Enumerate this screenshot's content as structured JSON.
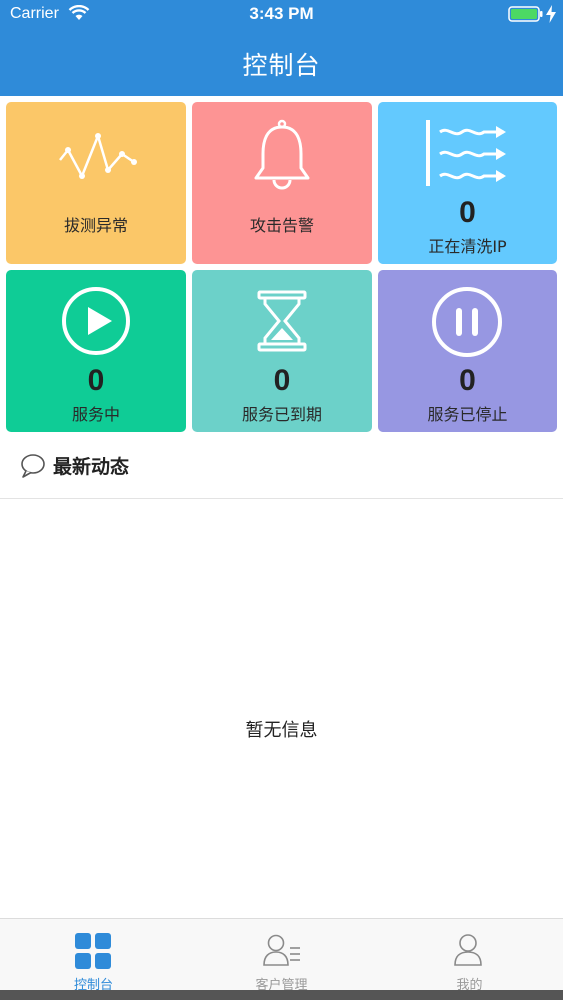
{
  "status_bar": {
    "carrier": "Carrier",
    "time": "3:43 PM"
  },
  "nav": {
    "title": "控制台"
  },
  "tiles": [
    {
      "label": "拔测异常",
      "icon": "wave-chart-icon",
      "color": "#fbc768"
    },
    {
      "label": "攻击告警",
      "icon": "bell-icon",
      "color": "#fd9494"
    },
    {
      "label": "正在清洗IP",
      "count": "0",
      "icon": "wind-flow-icon",
      "color": "#63c9fe"
    },
    {
      "label": "服务中",
      "count": "0",
      "icon": "play-icon",
      "color": "#0fcc96"
    },
    {
      "label": "服务已到期",
      "count": "0",
      "icon": "hourglass-icon",
      "color": "#6cd1c9"
    },
    {
      "label": "服务已停止",
      "count": "0",
      "icon": "pause-icon",
      "color": "#9797e2"
    }
  ],
  "news": {
    "title": "最新动态",
    "empty_message": "暂无信息"
  },
  "tabbar": {
    "items": [
      {
        "label": "控制台",
        "icon": "grid-icon",
        "active": true
      },
      {
        "label": "客户管理",
        "icon": "customer-list-icon",
        "active": false
      },
      {
        "label": "我的",
        "icon": "user-icon",
        "active": false
      }
    ],
    "active_color": "#2f8bd9"
  },
  "colors": {
    "header": "#2f8bd9"
  }
}
